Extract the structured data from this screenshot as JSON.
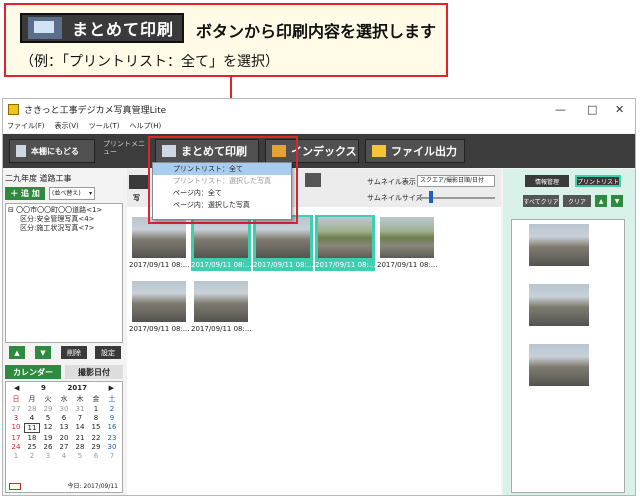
{
  "callout": {
    "button_label": "まとめて印刷",
    "text": "ボタンから印刷内容を選択します",
    "example": "（例：「プリントリスト：全て」を選択）"
  },
  "window": {
    "title": "さきっと工事デジカメ写真管理Lite",
    "menu": [
      "ファイル(F)",
      "表示(V)",
      "ツール(T)",
      "ヘルプ(H)"
    ],
    "controls": {
      "minimize": "—",
      "maximize": "□",
      "close": "✕"
    }
  },
  "toolbar": {
    "back_label": "本棚にもどる",
    "print_menu_label": "プリントメニュー",
    "batch_print_label": "まとめて印刷",
    "index_label": "インデックス",
    "file_output_label": "ファイル出力"
  },
  "left": {
    "project_title": "二九年度 道路工事",
    "add_label": "追 加",
    "sort_label": "(並べ替え)",
    "tree": [
      "〇〇市〇〇町〇〇道路<1>",
      "区分:安全管理写真<4>",
      "区分:施工状況写真<7>"
    ],
    "delete_label": "削除",
    "settings_label": "設定",
    "tab_calendar": "カレンダー",
    "tab_date": "撮影日付",
    "calendar": {
      "month": "9",
      "year": "2017",
      "weekdays": [
        "日",
        "月",
        "火",
        "水",
        "木",
        "金",
        "土"
      ],
      "days": [
        "27",
        "28",
        "29",
        "30",
        "31",
        "1",
        "2",
        "3",
        "4",
        "5",
        "6",
        "7",
        "8",
        "9",
        "10",
        "11",
        "12",
        "13",
        "14",
        "15",
        "16",
        "17",
        "18",
        "19",
        "20",
        "21",
        "22",
        "23",
        "24",
        "25",
        "26",
        "27",
        "28",
        "29",
        "30",
        "1",
        "2",
        "3",
        "4",
        "5",
        "6",
        "7"
      ],
      "today_label": "今日: 2017/09/11"
    }
  },
  "center": {
    "thumbnail_display_label": "サムネイル表示",
    "thumbnail_display_value": "スクエア/撮影日順/日付",
    "thumbnail_size_label": "サムネイルサイズ",
    "photo_tab_label": "写",
    "photos": [
      {
        "caption": "2017/09/11 08:..."
      },
      {
        "caption": "2017/09/11 08:..."
      },
      {
        "caption": "2017/09/11 08:..."
      },
      {
        "caption": "2017/09/11 08:..."
      },
      {
        "caption": "2017/09/11 08:..."
      },
      {
        "caption": "2017/09/11 08:..."
      },
      {
        "caption": "2017/09/11 08:..."
      }
    ]
  },
  "popup": {
    "items": [
      {
        "label": "プリントリスト：全て",
        "state": "active"
      },
      {
        "label": "プリントリスト：選択した写真",
        "state": "disabled"
      },
      {
        "label": "ページ内：全て",
        "state": "normal"
      },
      {
        "label": "ページ内：選択した写真",
        "state": "normal"
      }
    ]
  },
  "right": {
    "info_label": "情報管理",
    "print_list_label": "プリントリスト",
    "clear_all_label": "すべてクリア",
    "clear_label": "クリア"
  },
  "colors": {
    "accent_red": "#e3222e",
    "selection_teal": "#3ecfb0",
    "toolbar_dark": "#3c3c3c",
    "add_green": "#2d8a3e"
  }
}
